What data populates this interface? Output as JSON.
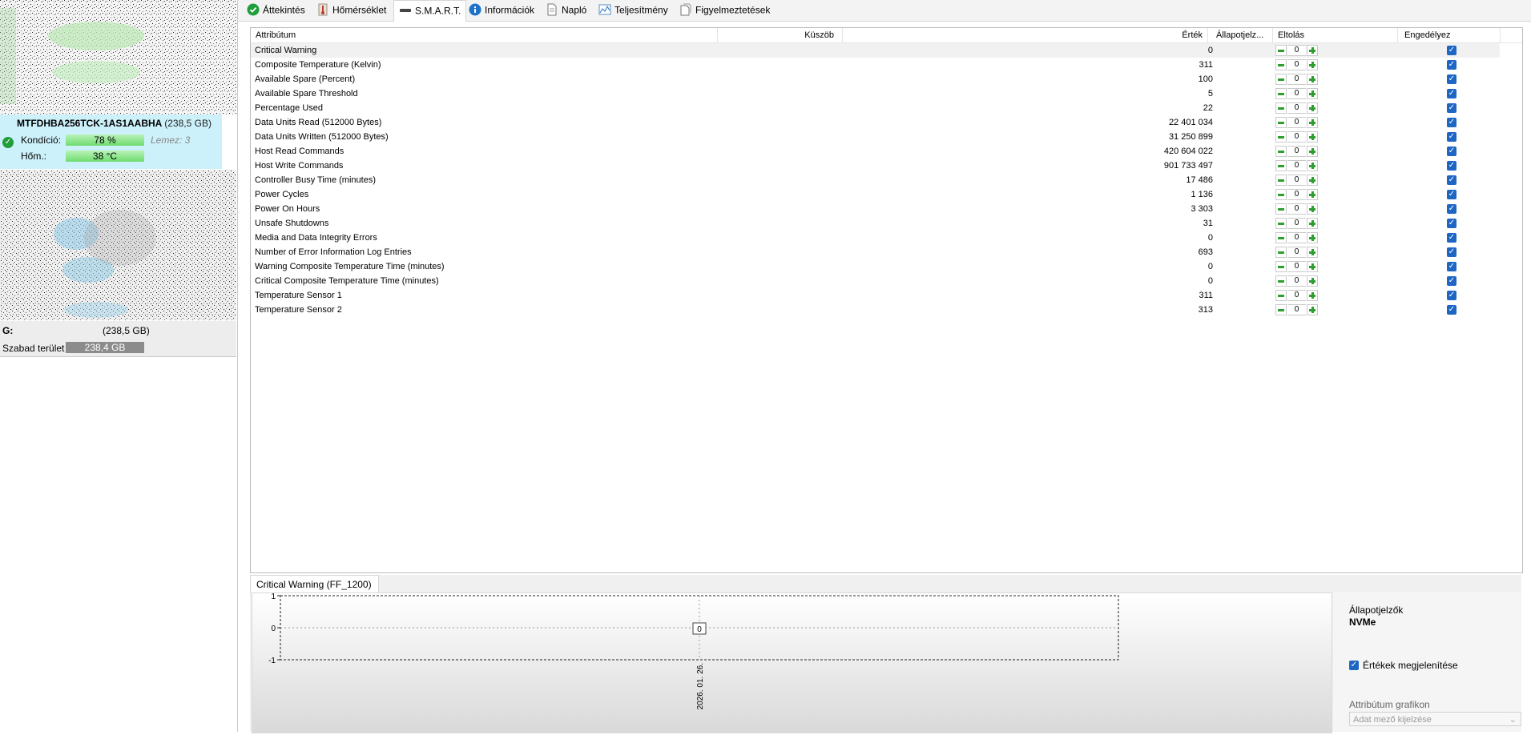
{
  "left_panel": {
    "disk1": {
      "model": "MTFDHBA256TCK-1AS1AABHA",
      "capacity": "(238,5 GB)",
      "health_label": "Kondíció:",
      "health_value": "78 %",
      "disk_label": "Lemez: 3",
      "temp_label": "Hőm.:",
      "temp_value": "38 °C"
    },
    "disk2": {
      "drive": "G:",
      "capacity": "(238,5 GB)",
      "free_label": "Szabad terület",
      "free_value": "238,4 GB"
    }
  },
  "tabs": [
    {
      "label": "Áttekintés",
      "icon": "checkmark-icon"
    },
    {
      "label": "Hőmérséklet",
      "icon": "thermometer-icon"
    },
    {
      "label": "S.M.A.R.T.",
      "icon": "smart-drive-icon"
    },
    {
      "label": "Információk",
      "icon": "info-icon"
    },
    {
      "label": "Napló",
      "icon": "document-icon"
    },
    {
      "label": "Teljesítmény",
      "icon": "performance-chart-icon"
    },
    {
      "label": "Figyelmeztetések",
      "icon": "warnings-icon"
    }
  ],
  "smart_table": {
    "columns": {
      "attribute": "Attribútum",
      "threshold": "Küszöb",
      "value": "Érték",
      "status": "Állapotjelz...",
      "offset": "Eltolás",
      "enabled": "Engedélyez"
    },
    "rows": [
      {
        "name": "Critical Warning",
        "value": "0",
        "offset": "0"
      },
      {
        "name": "Composite Temperature (Kelvin)",
        "value": "311",
        "offset": "0"
      },
      {
        "name": "Available Spare (Percent)",
        "value": "100",
        "offset": "0"
      },
      {
        "name": "Available Spare Threshold",
        "value": "5",
        "offset": "0"
      },
      {
        "name": "Percentage Used",
        "value": "22",
        "offset": "0"
      },
      {
        "name": "Data Units Read (512000 Bytes)",
        "value": "22 401 034",
        "offset": "0"
      },
      {
        "name": "Data Units Written (512000 Bytes)",
        "value": "31 250 899",
        "offset": "0"
      },
      {
        "name": "Host Read Commands",
        "value": "420 604 022",
        "offset": "0"
      },
      {
        "name": "Host Write Commands",
        "value": "901 733 497",
        "offset": "0"
      },
      {
        "name": "Controller Busy Time (minutes)",
        "value": "17 486",
        "offset": "0"
      },
      {
        "name": "Power Cycles",
        "value": "1 136",
        "offset": "0"
      },
      {
        "name": "Power On Hours",
        "value": "3 303",
        "offset": "0"
      },
      {
        "name": "Unsafe Shutdowns",
        "value": "31",
        "offset": "0"
      },
      {
        "name": "Media and Data Integrity Errors",
        "value": "0",
        "offset": "0"
      },
      {
        "name": "Number of Error Information Log Entries",
        "value": "693",
        "offset": "0"
      },
      {
        "name": "Warning Composite Temperature Time (minutes)",
        "value": "0",
        "offset": "0"
      },
      {
        "name": "Critical Composite Temperature Time (minutes)",
        "value": "0",
        "offset": "0"
      },
      {
        "name": "Temperature Sensor 1",
        "value": "311",
        "offset": "0"
      },
      {
        "name": "Temperature Sensor 2",
        "value": "313",
        "offset": "0"
      }
    ]
  },
  "graph": {
    "tab_label": "Critical Warning (FF_1200)",
    "y_ticks": [
      "1",
      "0",
      "-1"
    ],
    "x_label": "2026. 01. 26.",
    "point_label": "0"
  },
  "properties": {
    "status_title": "Állapotjelzők",
    "status_value": "NVMe",
    "show_values_label": "Értékek megjelenítése",
    "attribute_graph_label": "Attribútum grafikon",
    "select_placeholder": "Adat mező kijelzése"
  },
  "chart_data": {
    "type": "line",
    "x": [
      "2026. 01. 26."
    ],
    "series": [
      {
        "values": [
          0
        ]
      }
    ],
    "ylim": [
      -1,
      1
    ],
    "grid": true
  },
  "colors": {
    "disk_info_bg": "#cdf1fb",
    "health_bar": "#6fdc6f",
    "checkbox": "#1e66c4",
    "stepper_green": "#2e9f2e",
    "free_bar": "#8c8c8c"
  }
}
